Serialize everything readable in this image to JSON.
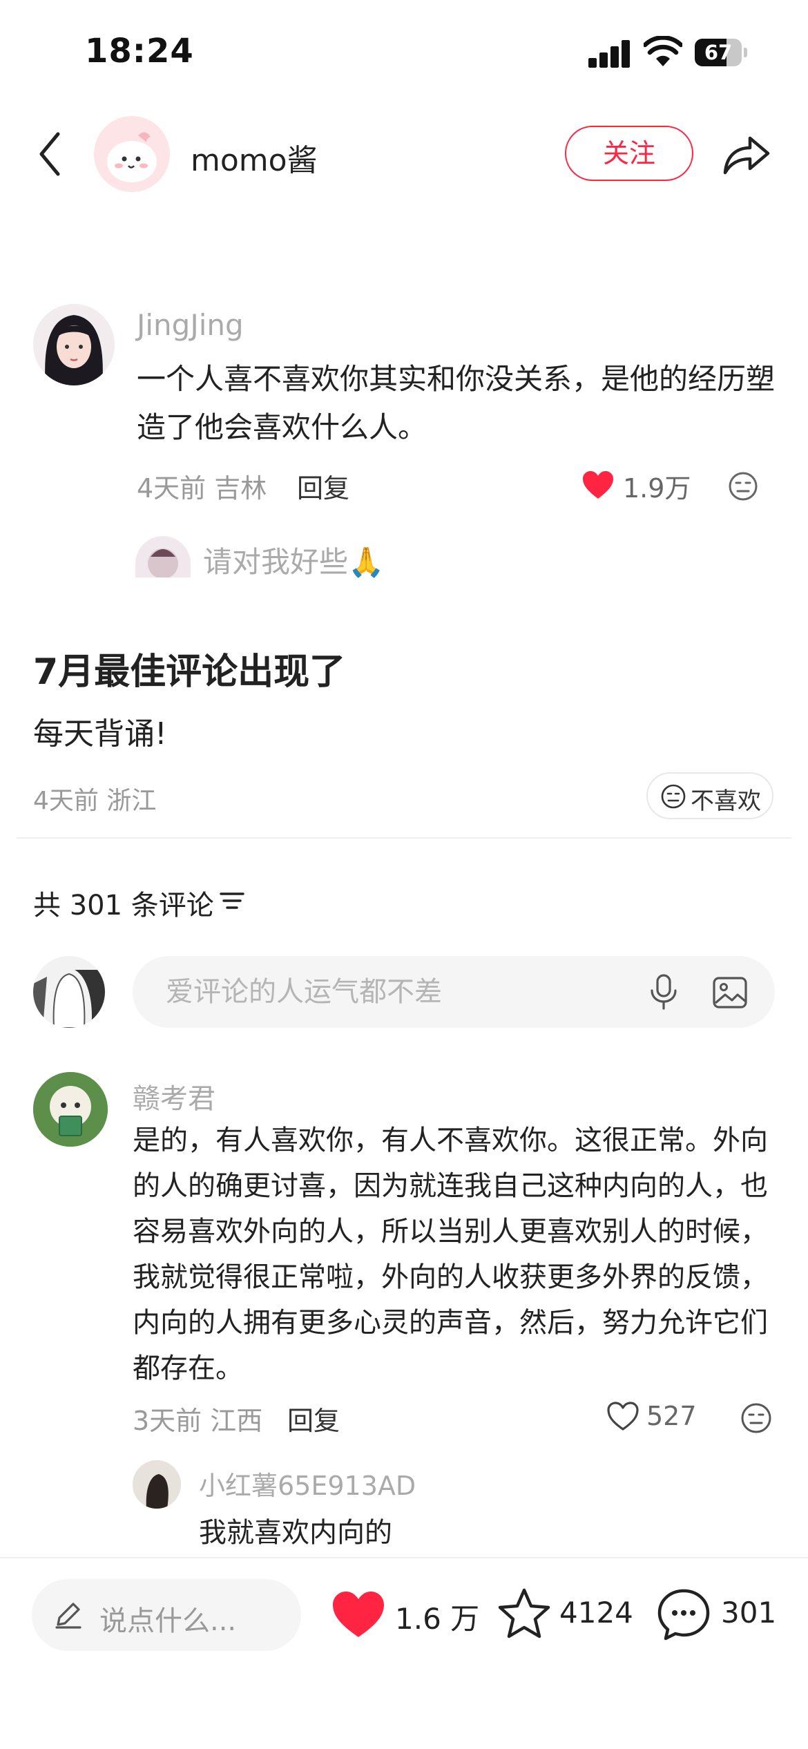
{
  "status_bar": {
    "time": "18:24",
    "battery": "67",
    "battery_fraction": 0.67
  },
  "header": {
    "author_name": "momo酱",
    "follow_label": "关注",
    "icons": [
      "back-arrow-icon",
      "share-icon"
    ]
  },
  "quoted_comment": {
    "username": "JingJing",
    "text": "一个人喜不喜欢你其实和你没关系，是他的经历塑造了他会喜欢什么人。",
    "meta": "4天前 吉林",
    "reply_label": "回复",
    "likes": "1.9万",
    "sub_reply_text": "请对我好些🙏"
  },
  "post": {
    "title": "7月最佳评论出现了",
    "body": "每天背诵!",
    "meta": "4天前 浙江",
    "dislike_label": "不喜欢"
  },
  "comments_section": {
    "count_label": "共 301 条评论",
    "input_placeholder": "爱评论的人运气都不差",
    "comments": [
      {
        "username": "赣考君",
        "text": "是的，有人喜欢你，有人不喜欢你。这很正常。外向的人的确更讨喜，因为就连我自己这种内向的人，也容易喜欢外向的人，所以当别人更喜欢别人的时候，我就觉得很正常啦，外向的人收获更多外界的反馈，内向的人拥有更多心灵的声音，然后，努力允许它们都存在。",
        "meta": "3天前 江西",
        "reply_label": "回复",
        "likes": "527",
        "replies": [
          {
            "username": "小红薯65E913AD",
            "text": "我就喜欢内向的"
          }
        ]
      }
    ]
  },
  "bottom_bar": {
    "say_placeholder": "说点什么...",
    "likes": "1.6 万",
    "stars": "4124",
    "comments": "301"
  },
  "colors": {
    "accent_red": "#ff2442",
    "muted_text": "#999999",
    "input_bg": "#f5f5f5"
  }
}
